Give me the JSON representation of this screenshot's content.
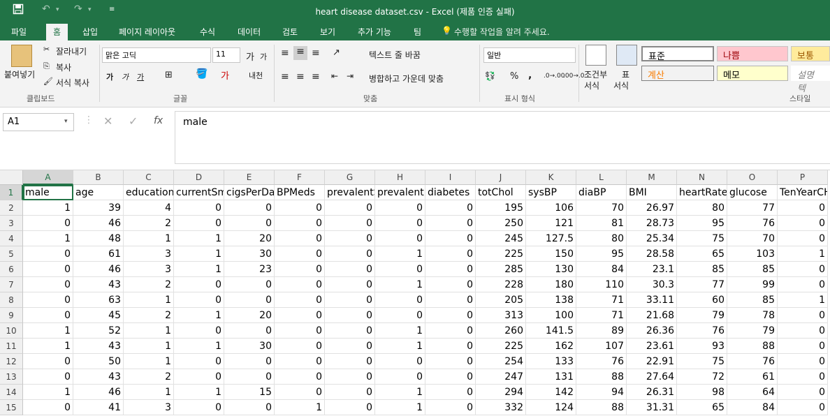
{
  "window": {
    "title": "heart disease dataset.csv - Excel (제품 인증 실패)"
  },
  "qat": {
    "save_icon": "save-icon",
    "undo_icon": "undo-icon",
    "redo_icon": "redo-icon",
    "customize_icon": "customize-icon"
  },
  "tabs": [
    "파일",
    "홈",
    "삽입",
    "페이지 레이아웃",
    "수식",
    "데이터",
    "검토",
    "보기",
    "추가 기능",
    "팀"
  ],
  "search_hint": "수행할 작업을 알려 주세요.",
  "ribbon": {
    "clipboard": {
      "paste": "붙여넣기",
      "cut": "잘라내기",
      "copy": "복사",
      "format_painter": "서식 복사",
      "label": "클립보드"
    },
    "font": {
      "name": "맑은 고딕",
      "size": "11",
      "bold": "가",
      "italic": "가",
      "underline": "가",
      "label": "글꼴"
    },
    "alignment": {
      "wrap": "텍스트 줄 바꿈",
      "merge": "병합하고 가운데 맞춤",
      "label": "맞춤"
    },
    "number": {
      "format": "일반",
      "percent": "%",
      "comma": ",",
      "label": "표시 형식"
    },
    "cond": {
      "line1": "조건부",
      "line2": "서식"
    },
    "table": {
      "line1": "표",
      "line2": "서식"
    },
    "styles": {
      "normal": "표준",
      "bad": "나쁨",
      "neutral": "보통",
      "calc": "계산",
      "note": "메모",
      "explain": "설명 텍",
      "label": "스타일"
    }
  },
  "formula_bar": {
    "name_box": "A1",
    "content": "male"
  },
  "sheet": {
    "columns": [
      "A",
      "B",
      "C",
      "D",
      "E",
      "F",
      "G",
      "H",
      "I",
      "J",
      "K",
      "L",
      "M",
      "N",
      "O",
      "P"
    ],
    "headers": [
      "male",
      "age",
      "education",
      "currentSm",
      "cigsPerDay",
      "BPMeds",
      "prevalentS",
      "prevalentH",
      "diabetes",
      "totChol",
      "sysBP",
      "diaBP",
      "BMI",
      "heartRate",
      "glucose",
      "TenYearCH"
    ],
    "row_numbers": [
      "1",
      "2",
      "3",
      "4",
      "5",
      "6",
      "7",
      "8",
      "9",
      "10",
      "11",
      "12",
      "13",
      "14",
      "15"
    ],
    "rows": [
      [
        "1",
        "39",
        "4",
        "0",
        "0",
        "0",
        "0",
        "0",
        "0",
        "195",
        "106",
        "70",
        "26.97",
        "80",
        "77",
        "0"
      ],
      [
        "0",
        "46",
        "2",
        "0",
        "0",
        "0",
        "0",
        "0",
        "0",
        "250",
        "121",
        "81",
        "28.73",
        "95",
        "76",
        "0"
      ],
      [
        "1",
        "48",
        "1",
        "1",
        "20",
        "0",
        "0",
        "0",
        "0",
        "245",
        "127.5",
        "80",
        "25.34",
        "75",
        "70",
        "0"
      ],
      [
        "0",
        "61",
        "3",
        "1",
        "30",
        "0",
        "0",
        "1",
        "0",
        "225",
        "150",
        "95",
        "28.58",
        "65",
        "103",
        "1"
      ],
      [
        "0",
        "46",
        "3",
        "1",
        "23",
        "0",
        "0",
        "0",
        "0",
        "285",
        "130",
        "84",
        "23.1",
        "85",
        "85",
        "0"
      ],
      [
        "0",
        "43",
        "2",
        "0",
        "0",
        "0",
        "0",
        "1",
        "0",
        "228",
        "180",
        "110",
        "30.3",
        "77",
        "99",
        "0"
      ],
      [
        "0",
        "63",
        "1",
        "0",
        "0",
        "0",
        "0",
        "0",
        "0",
        "205",
        "138",
        "71",
        "33.11",
        "60",
        "85",
        "1"
      ],
      [
        "0",
        "45",
        "2",
        "1",
        "20",
        "0",
        "0",
        "0",
        "0",
        "313",
        "100",
        "71",
        "21.68",
        "79",
        "78",
        "0"
      ],
      [
        "1",
        "52",
        "1",
        "0",
        "0",
        "0",
        "0",
        "1",
        "0",
        "260",
        "141.5",
        "89",
        "26.36",
        "76",
        "79",
        "0"
      ],
      [
        "1",
        "43",
        "1",
        "1",
        "30",
        "0",
        "0",
        "1",
        "0",
        "225",
        "162",
        "107",
        "23.61",
        "93",
        "88",
        "0"
      ],
      [
        "0",
        "50",
        "1",
        "0",
        "0",
        "0",
        "0",
        "0",
        "0",
        "254",
        "133",
        "76",
        "22.91",
        "75",
        "76",
        "0"
      ],
      [
        "0",
        "43",
        "2",
        "0",
        "0",
        "0",
        "0",
        "0",
        "0",
        "247",
        "131",
        "88",
        "27.64",
        "72",
        "61",
        "0"
      ],
      [
        "1",
        "46",
        "1",
        "1",
        "15",
        "0",
        "0",
        "1",
        "0",
        "294",
        "142",
        "94",
        "26.31",
        "98",
        "64",
        "0"
      ],
      [
        "0",
        "41",
        "3",
        "0",
        "0",
        "1",
        "0",
        "1",
        "0",
        "332",
        "124",
        "88",
        "31.31",
        "65",
        "84",
        "0"
      ]
    ]
  },
  "colors": {
    "accent": "#217346",
    "bad_bg": "#ffc7ce",
    "bad_fg": "#9c0006",
    "neutral_bg": "#ffeb9c",
    "neutral_fg": "#9c5700",
    "calc_fg": "#fa7d00",
    "note_bg": "#ffffcc"
  }
}
